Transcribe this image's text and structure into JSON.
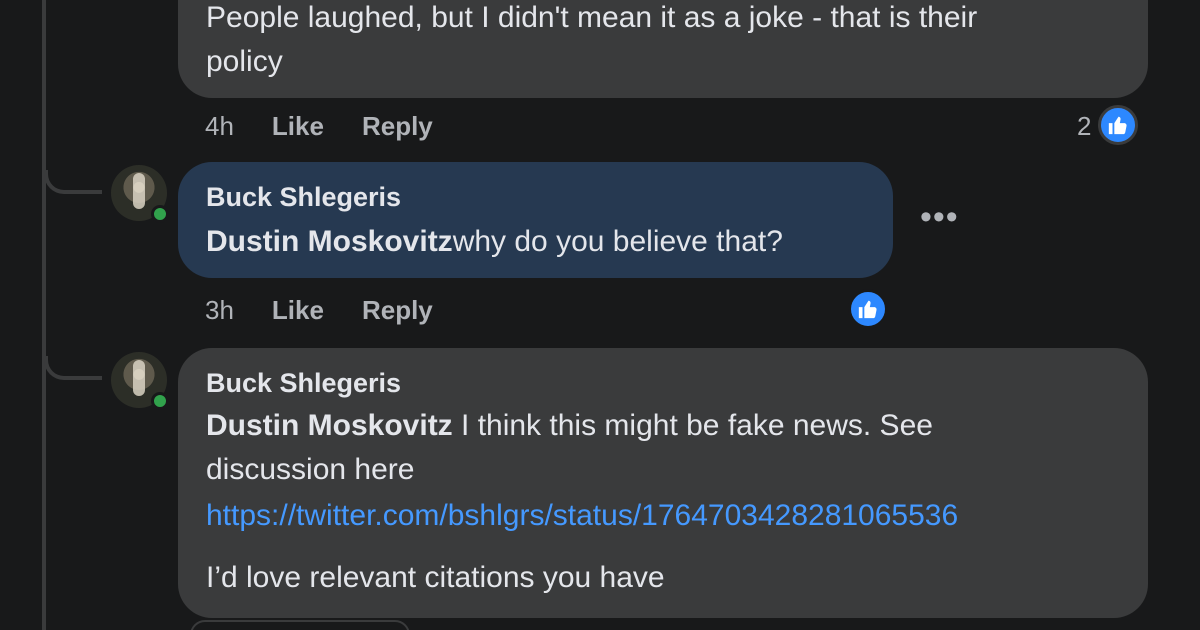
{
  "comments": [
    {
      "text_lines": [
        "People laughed, but I didn't mean it as a joke - that is their",
        "policy"
      ],
      "time": "4h",
      "like_label": "Like",
      "reply_label": "Reply",
      "reaction_count": "2"
    },
    {
      "author": "Buck Shlegeris",
      "mention": "Dustin Moskovitz",
      "text": "why do you believe that?",
      "time": "3h",
      "like_label": "Like",
      "reply_label": "Reply",
      "more_label": "•••"
    },
    {
      "author": "Buck Shlegeris",
      "mention": "Dustin Moskovitz",
      "text_after_mention": " I think this might be fake news. See",
      "text_line2": "discussion here",
      "link": "https://twitter.com/bshlgrs/status/1764703428281065536",
      "text_line4": "I’d love relevant citations you have"
    }
  ],
  "icons": {
    "like": "thumbs-up-icon",
    "online": "online-status-dot",
    "more": "more-options-icon"
  },
  "colors": {
    "background": "#18191a",
    "bubble": "#3a3b3c",
    "highlight_bubble": "#263951",
    "link": "#4599ff",
    "like_blue": "#2d88ff",
    "online_green": "#31a24c"
  }
}
